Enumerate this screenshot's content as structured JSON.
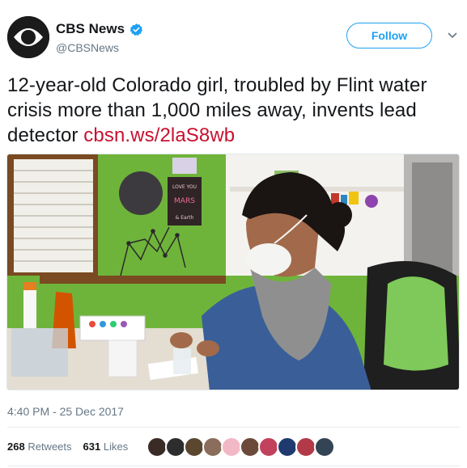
{
  "account": {
    "name": "CBS News",
    "handle": "@CBSNews",
    "follow_label": "Follow"
  },
  "tweet": {
    "text": "12-year-old Colorado girl, troubled by Flint water crisis more than 1,000 miles away, invents lead detector ",
    "link_text": "cbsn.ws/2laS8wb",
    "timestamp": "4:40 PM - 25 Dec 2017"
  },
  "media": {
    "poster_line1": "LOVE YOU",
    "poster_line2": "MARS",
    "poster_line3": "& Earth"
  },
  "stats": {
    "retweets_count": "268",
    "retweets_label": "Retweets",
    "likes_count": "631",
    "likes_label": "Likes"
  },
  "likers": [
    "#3a2b27",
    "#2d2d2d",
    "#5b4630",
    "#8a6d5a",
    "#f2b8c6",
    "#6b4a3a",
    "#c2415d",
    "#1f3a6e",
    "#b23a48",
    "#334455"
  ],
  "colors": {
    "accent": "#1da1f2",
    "link": "#c8102e",
    "wall_green": "#6fb43a"
  }
}
